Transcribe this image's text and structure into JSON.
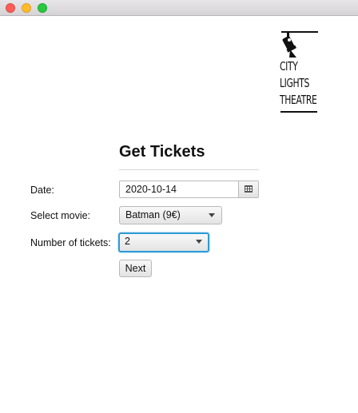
{
  "window": {
    "controls": [
      "close",
      "minimize",
      "maximize"
    ]
  },
  "logo": {
    "lines": [
      "CITY",
      "LIGHTS",
      "THEATRE"
    ],
    "icon": "spotlight-icon"
  },
  "form": {
    "title": "Get Tickets",
    "date": {
      "label": "Date:",
      "value": "2020-10-14",
      "button_icon": "calendar-icon"
    },
    "movie": {
      "label": "Select movie:",
      "value": "Batman (9€)"
    },
    "tickets": {
      "label": "Number of tickets:",
      "value": "2"
    },
    "next_label": "Next"
  },
  "colors": {
    "focus_ring": "#2e9bd6",
    "close": "#fc5f57",
    "minimize": "#fdbc2e",
    "maximize": "#28c840"
  }
}
